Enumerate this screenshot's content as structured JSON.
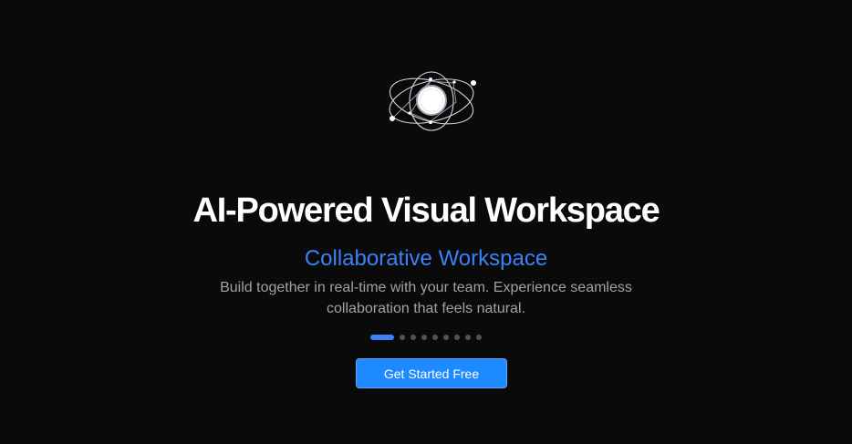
{
  "hero": {
    "logo_icon": "orbit-atom-icon",
    "title": "AI-Powered Visual Workspace",
    "subtitle": "Collaborative Workspace",
    "description": "Build together in real-time with your team. Experience seamless collaboration that feels natural.",
    "carousel": {
      "total_slides": 9,
      "active_index": 0
    },
    "cta_label": "Get Started Free"
  },
  "colors": {
    "background": "#0a0a0a",
    "accent": "#3b82f6",
    "button": "#1d8bff",
    "muted_text": "#a1a1aa",
    "inactive_dot": "#52525b"
  }
}
